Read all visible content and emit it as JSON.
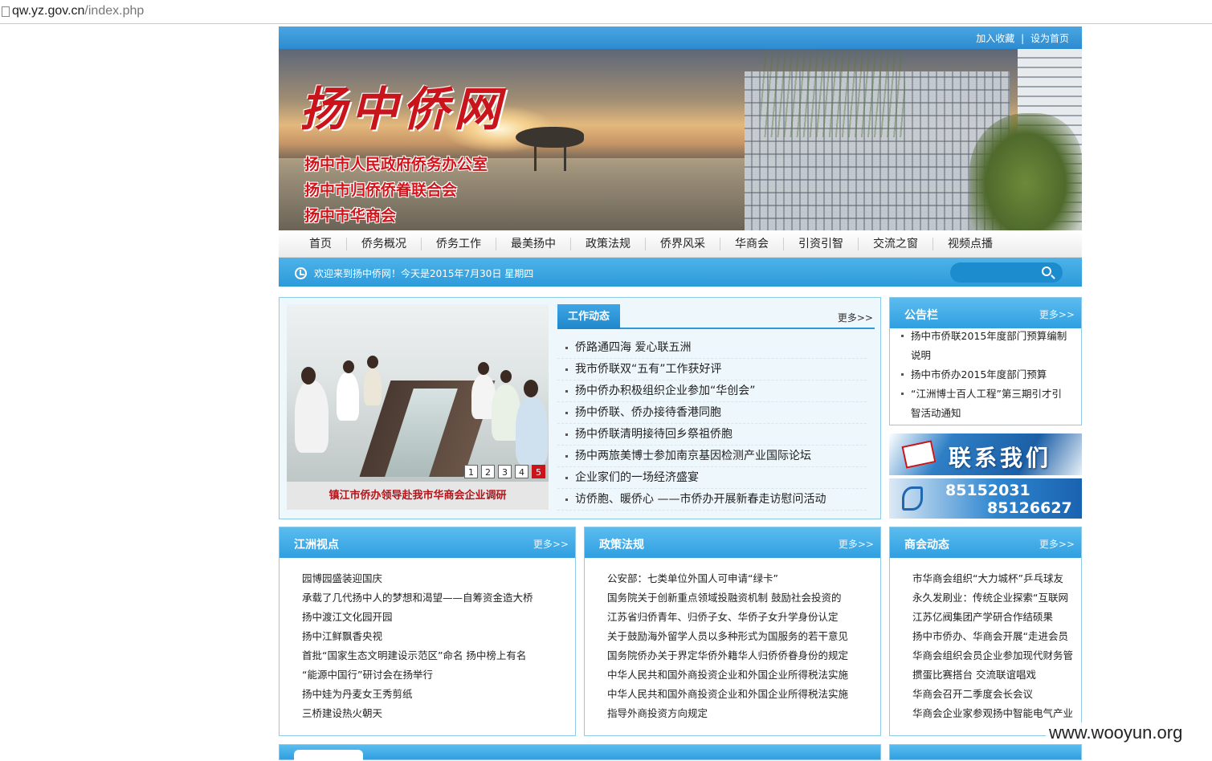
{
  "browser": {
    "url_host": "qw.yz.gov.cn",
    "url_path": "/index.php"
  },
  "topbar": {
    "bookmark": "加入收藏",
    "separator": "|",
    "homepage": "设为首页"
  },
  "banner": {
    "logo_text": "扬中侨网",
    "orgs": [
      "扬中市人民政府侨务办公室",
      "扬中市归侨侨眷联合会",
      "扬中市华商会"
    ]
  },
  "nav": [
    "首页",
    "侨务概况",
    "侨务工作",
    "最美扬中",
    "政策法规",
    "侨界风采",
    "华商会",
    "引资引智",
    "交流之窗",
    "视频点播"
  ],
  "welcome": {
    "message": "欢迎来到扬中侨网！今天是2015年7月30日 星期四",
    "search_placeholder": ""
  },
  "slideshow": {
    "caption": "镇江市侨办领导赴我市华商会企业调研",
    "pages": [
      "1",
      "2",
      "3",
      "4",
      "5"
    ],
    "active_page": 5
  },
  "work_news": {
    "title": "工作动态",
    "more": "更多>>",
    "items": [
      "侨路通四海 爱心联五洲",
      "我市侨联双“五有”工作获好评",
      "扬中侨办积极组织企业参加“华创会”",
      "扬中侨联、侨办接待香港同胞",
      "扬中侨联清明接待回乡祭祖侨胞",
      "扬中两旅美博士参加南京基因检测产业国际论坛",
      "企业家们的一场经济盛宴",
      "访侨胞、暖侨心 ——市侨办开展新春走访慰问活动"
    ]
  },
  "notice": {
    "title": "公告栏",
    "more": "更多>>",
    "items": [
      "扬中市侨联2015年度部门预算编制说明",
      "扬中市侨办2015年度部门预算",
      "“江洲博士百人工程”第三期引才引智活动通知"
    ]
  },
  "contact": {
    "title": "联系我们",
    "phone1": "85152031",
    "phone2": "85126627"
  },
  "box1": {
    "title": "江洲视点",
    "more": "更多>>",
    "items": [
      "园博园盛装迎国庆",
      "承载了几代扬中人的梦想和渴望——自筹资金造大桥",
      "扬中渡江文化园开园",
      "扬中江鲜飘香央视",
      "首批“国家生态文明建设示范区”命名 扬中榜上有名",
      "“能源中国行”研讨会在扬举行",
      "扬中娃为丹麦女王秀剪纸",
      "三桥建设热火朝天"
    ]
  },
  "box2": {
    "title": "政策法规",
    "more": "更多>>",
    "items": [
      "公安部：七类单位外国人可申请“绿卡”",
      "国务院关于创新重点领域投融资机制 鼓励社会投资的",
      "江苏省归侨青年、归侨子女、华侨子女升学身份认定",
      "关于鼓励海外留学人员以多种形式为国服务的若干意见",
      "国务院侨办关于界定华侨外籍华人归侨侨眷身份的规定",
      "中华人民共和国外商投资企业和外国企业所得税法实施",
      "中华人民共和国外商投资企业和外国企业所得税法实施",
      "指导外商投资方向规定"
    ]
  },
  "box3": {
    "title": "商会动态",
    "more": "更多>>",
    "items": [
      "市华商会组织“大力城杯”乒乓球友",
      "永久发刷业：传统企业探索“互联网",
      "江苏亿阀集团产学研合作结硕果",
      "扬中市侨办、华商会开展“走进会员",
      "华商会组织会员企业参加现代财务管",
      "掼蛋比赛搭台 交流联谊唱戏",
      "华商会召开二季度会长会议",
      "华商会企业家参观扬中智能电气产业"
    ]
  },
  "watermark": "www.wooyun.org"
}
